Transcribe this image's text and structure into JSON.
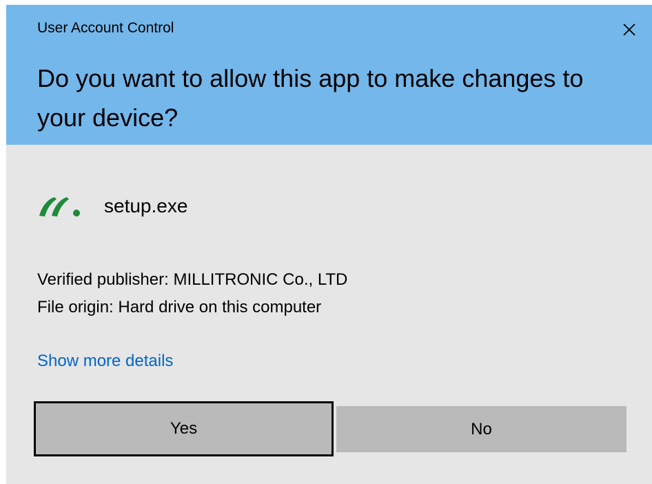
{
  "dialog": {
    "title": "User Account Control",
    "question": "Do you want to allow this app to make changes to your device?",
    "header_color": "#74b7eb",
    "body_color": "#e6e6e6"
  },
  "app": {
    "icon": "millitronic-logo-icon",
    "name": "setup.exe"
  },
  "info": {
    "publisher": "Verified publisher: MILLITRONIC Co., LTD",
    "origin": "File origin: Hard drive on this computer"
  },
  "details_link": "Show more details",
  "buttons": {
    "yes": "Yes",
    "no": "No"
  },
  "close_icon": "close-icon"
}
